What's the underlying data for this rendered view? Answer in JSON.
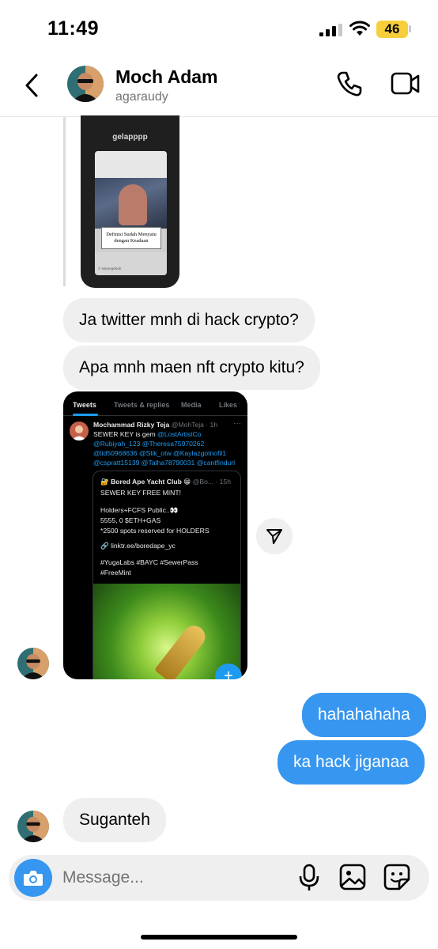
{
  "status_bar": {
    "time": "11:49",
    "battery": "46"
  },
  "header": {
    "name": "Moch Adam",
    "handle": "agaraudy"
  },
  "shared_story": {
    "caption": "gelapppp",
    "label": "Definisi Sudah Menyatu dengan Keadaan",
    "credit": "© sepongebob"
  },
  "messages": {
    "m1": "Ja twitter mnh di hack crypto?",
    "m2": "Apa mnh maen nft crypto kitu?",
    "m3": "hahahahaha",
    "m4": "ka hack jiganaa",
    "m5": "Suganteh"
  },
  "tweet": {
    "tabs": [
      "Tweets",
      "Tweets & replies",
      "Media",
      "Likes"
    ],
    "author": "Mochammad Rizky Teja",
    "handle": "@MohTeja · 1h",
    "text_start": "SEWER KEY is gem ",
    "mention_1": "@LostArtistCo",
    "line_2": "@Rubiyah_123 @Theresa75970262",
    "line_3": "@lid50968636 @Slik_otw @Kaylazgotnofil1",
    "line_4": "@cspratt15139 @Talha78790031 @cantfindurl",
    "quote": {
      "author": "🔐 Bored Ape Yacht Club 😁",
      "handle": "@Bo... · 15h",
      "l1": "SEWER KEY FREE MINT!",
      "l2": "Holders+FCFS Public..👀",
      "l3": "5555, 0 $ETH+GAS",
      "l4": "*2500 spots reserved for HOLDERS",
      "l5": "🔗 linktr.ee/boredape_yc",
      "l6": "#YugaLabs #BAYC #SewerPass",
      "l7": "#FreeMint"
    }
  },
  "composer": {
    "placeholder": "Message..."
  },
  "icons": {
    "back": "chevron-left-icon",
    "call": "phone-icon",
    "video": "video-camera-icon",
    "share": "paper-plane-icon",
    "camera": "camera-icon",
    "mic": "microphone-icon",
    "gallery": "image-icon",
    "sticker": "sticker-icon"
  },
  "colors": {
    "outgoing": "#3797f0",
    "incoming": "#efefef",
    "twitter_blue": "#1d9bf0",
    "battery": "#f7cf3c"
  }
}
